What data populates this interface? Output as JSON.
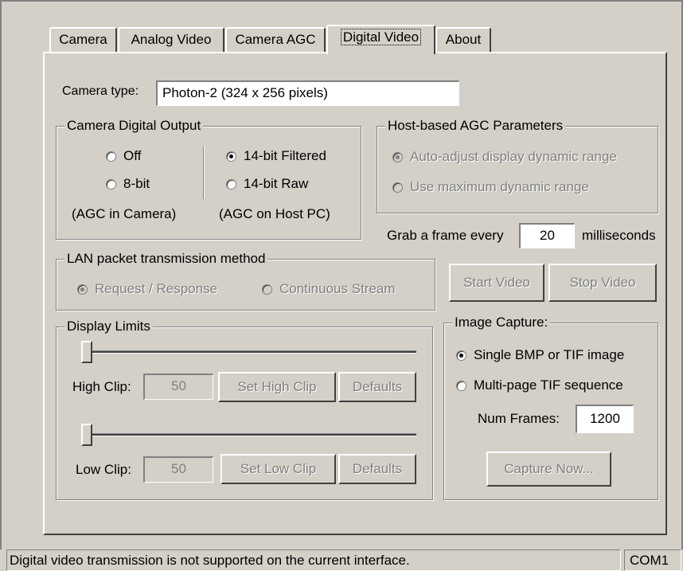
{
  "tabs": [
    {
      "label": "Camera"
    },
    {
      "label": "Analog Video"
    },
    {
      "label": "Camera AGC"
    },
    {
      "label": "Digital Video",
      "active": true
    },
    {
      "label": "About"
    }
  ],
  "camera_type": {
    "label": "Camera type:",
    "value": "Photon-2 (324 x 256 pixels)"
  },
  "digital_output": {
    "title": "Camera Digital Output",
    "off": "Off",
    "bit8": "8-bit",
    "agc_camera": "(AGC in Camera)",
    "filtered14": "14-bit Filtered",
    "raw14": "14-bit Raw",
    "agc_host": "(AGC on Host PC)",
    "selected": "14-bit Filtered"
  },
  "host_agc": {
    "title": "Host-based AGC Parameters",
    "auto": "Auto-adjust display dynamic range",
    "max": "Use maximum dynamic range",
    "selected": "Auto-adjust display dynamic range"
  },
  "grab": {
    "label": "Grab a frame every",
    "value": "20",
    "unit": "milliseconds"
  },
  "lan": {
    "title": "LAN packet transmission method",
    "request": "Request / Response",
    "continuous": "Continuous Stream",
    "selected": "Request / Response"
  },
  "video_buttons": {
    "start": "Start Video",
    "stop": "Stop Video"
  },
  "display_limits": {
    "title": "Display Limits",
    "high_label": "High Clip:",
    "high_value": "50",
    "set_high": "Set High Clip",
    "defaults": "Defaults",
    "low_label": "Low Clip:",
    "low_value": "50",
    "set_low": "Set Low Clip"
  },
  "image_capture": {
    "title": "Image Capture:",
    "single": "Single BMP or TIF image",
    "multi": "Multi-page TIF sequence",
    "num_frames_label": "Num Frames:",
    "num_frames": "1200",
    "capture": "Capture Now...",
    "selected": "Single BMP or TIF image"
  },
  "status": {
    "message": "Digital video transmission is not supported on the current interface.",
    "port": "COM1"
  }
}
